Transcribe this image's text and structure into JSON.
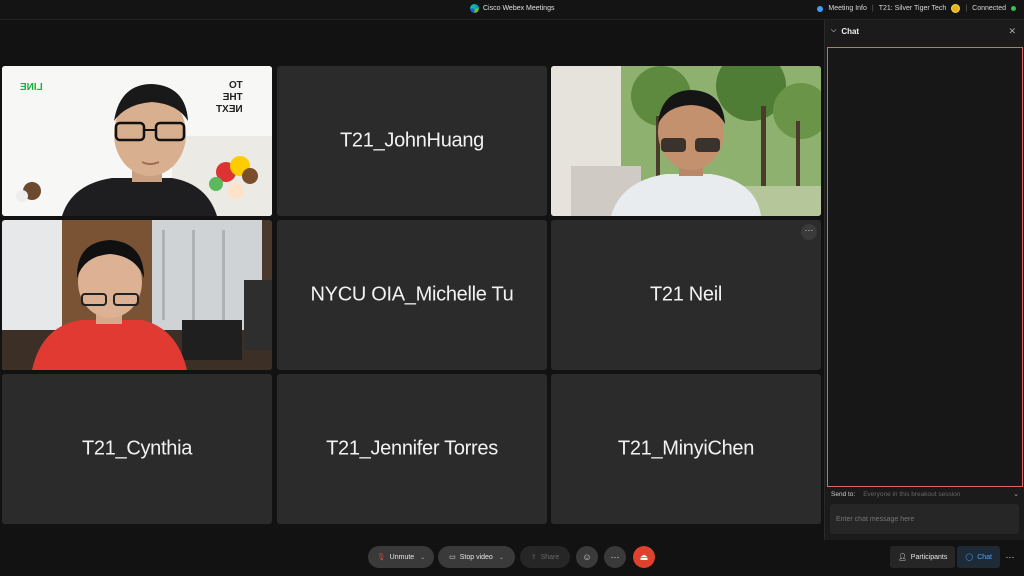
{
  "titlebar": {
    "app_title": "Cisco Webex Meetings",
    "meeting_info": "Meeting Info",
    "meeting_name": "T21: Silver Tiger Tech",
    "connection_status": "Connected"
  },
  "tiles": [
    {
      "name": "",
      "type": "video",
      "icon": "person-line-background"
    },
    {
      "name": "T21_JohnHuang",
      "type": "name"
    },
    {
      "name": "",
      "type": "video",
      "icon": "person-trees-background"
    },
    {
      "name": "",
      "type": "video",
      "icon": "person-office-background"
    },
    {
      "name": "NYCU OIA_Michelle Tu",
      "type": "name"
    },
    {
      "name": "T21 Neil",
      "type": "name",
      "has_more": true
    },
    {
      "name": "T21_Cynthia",
      "type": "name"
    },
    {
      "name": "T21_Jennifer Torres",
      "type": "name"
    },
    {
      "name": "T21_MinyiChen",
      "type": "name"
    }
  ],
  "tile1_text": {
    "left": "LINE",
    "right": "TO\nTHE\nNEXT"
  },
  "chat": {
    "title": "Chat",
    "send_to_label": "Send to:",
    "send_to_target": "Everyone in this breakout session",
    "input_placeholder": "Enter chat message here"
  },
  "toolbar": {
    "unmute": "Unmute",
    "stop_video": "Stop video",
    "share": "Share",
    "participants": "Participants",
    "chat": "Chat"
  },
  "colors": {
    "end_button": "#e0402e",
    "chat_accent": "#4aa3ff",
    "connected": "#32c15a"
  }
}
